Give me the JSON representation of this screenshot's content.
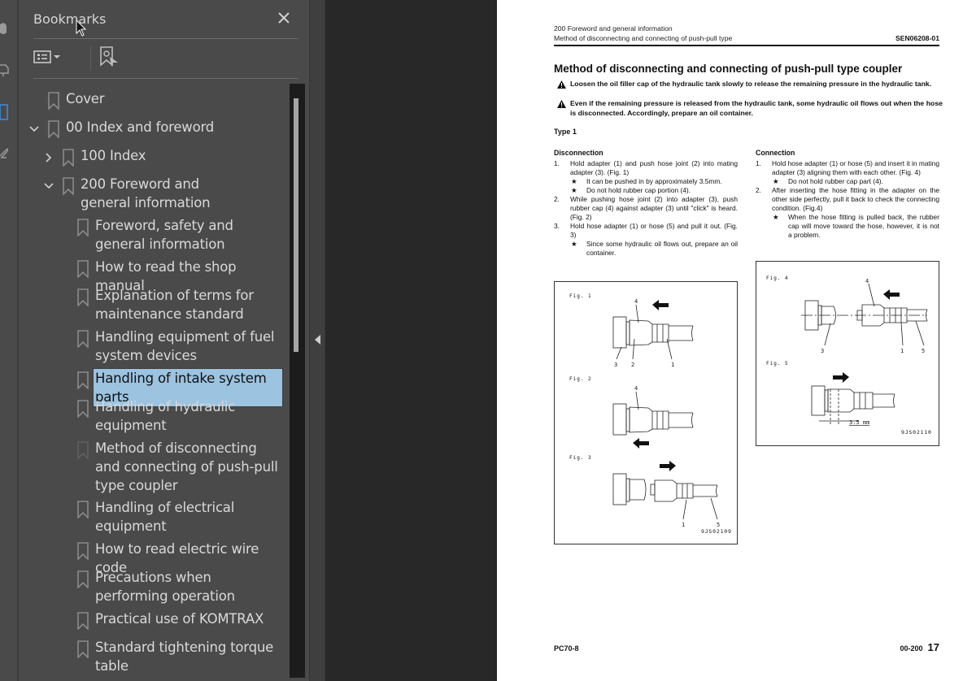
{
  "panel": {
    "title": "Bookmarks",
    "close_label": "Close",
    "options_icon": "list-options-icon",
    "find_bookmark_icon": "find-current-bookmark-icon"
  },
  "bookmarks": [
    {
      "label": "Cover",
      "level": 0,
      "expander": "none",
      "selected": false
    },
    {
      "label": "00 Index and foreword",
      "level": 0,
      "expander": "expanded",
      "selected": false
    },
    {
      "label": "100 Index",
      "level": 1,
      "expander": "collapsed",
      "selected": false
    },
    {
      "label": "200 Foreword and general information",
      "level": 1,
      "expander": "expanded",
      "selected": false
    },
    {
      "label": "Foreword, safety and general information",
      "level": 2,
      "expander": "none",
      "selected": false
    },
    {
      "label": "How to read the shop manual",
      "level": 2,
      "expander": "none",
      "selected": false
    },
    {
      "label": "Explanation of terms for maintenance standard",
      "level": 2,
      "expander": "none",
      "selected": false
    },
    {
      "label": "Handling equipment of fuel system devices",
      "level": 2,
      "expander": "none",
      "selected": false
    },
    {
      "label": "Handling of intake system parts",
      "level": 2,
      "expander": "none",
      "selected": true
    },
    {
      "label": "Handling of hydraulic equipment",
      "level": 2,
      "expander": "none",
      "selected": false
    },
    {
      "label": "Method of disconnecting and connecting of push-pull type coupler",
      "level": 2,
      "expander": "none",
      "selected": false
    },
    {
      "label": "Handling of electrical equipment",
      "level": 2,
      "expander": "none",
      "selected": false
    },
    {
      "label": "How to read electric wire code",
      "level": 2,
      "expander": "none",
      "selected": false
    },
    {
      "label": "Precautions when performing operation",
      "level": 2,
      "expander": "none",
      "selected": false
    },
    {
      "label": "Practical use of KOMTRAX",
      "level": 2,
      "expander": "none",
      "selected": false
    },
    {
      "label": "Standard tightening torque table",
      "level": 2,
      "expander": "none",
      "selected": false
    }
  ],
  "page": {
    "header_line1": "200 Foreword and general information",
    "header_line2": "Method of disconnecting and connecting of push-pull type",
    "doc_code": "SEN06208-01",
    "title": "Method of disconnecting and connecting of push-pull type coupler",
    "warnings": [
      "Loosen the oil filler cap of the hydraulic tank slowly to release the remaining pressure in the hydraulic tank.",
      "Even if the remaining pressure is released from the hydraulic tank, some hydraulic oil flows out when the hose is disconnected. Accordingly, prepare an oil container."
    ],
    "type_label": "Type 1",
    "disconnection": {
      "heading": "Disconnection",
      "steps": [
        {
          "num": "1.",
          "text": "Hold adapter (1) and push hose joint (2) into mating adapter (3).  (Fig. 1)",
          "notes": [
            "It can be pushed in by approximately 3.5mm.",
            "Do not hold rubber cap portion (4)."
          ]
        },
        {
          "num": "2.",
          "text": "While pushing hose joint (2) into adapter (3), push rubber cap (4) against adapter (3) until \"click\" is heard. (Fig. 2)",
          "notes": []
        },
        {
          "num": "3.",
          "text": "Hold hose adapter (1) or hose (5) and pull it out.  (Fig. 3)",
          "notes": [
            "Since some hydraulic oil flows out, prepare an oil container."
          ]
        }
      ]
    },
    "connection": {
      "heading": "Connection",
      "steps": [
        {
          "num": "1.",
          "text": "Hold hose adapter (1) or hose (5) and insert it in mating adapter (3) aligning them with each other. (Fig. 4)",
          "notes": [
            "Do not hold rubber cap part (4)."
          ]
        },
        {
          "num": "2.",
          "text": "After inserting the hose fitting in the adapter on the other side perfectly, pull it back to check the connecting condition. (Fig.4)",
          "notes": [
            "When the hose fitting is pulled back, the rubber cap will move toward the hose, however, it is not a problem."
          ]
        }
      ]
    },
    "star": "★",
    "figures_left": {
      "fig1": "Fig. 1",
      "fig2": "Fig. 2",
      "fig3": "Fig. 3",
      "code": "9JS02109",
      "callouts": {
        "fig1": [
          "4",
          "3",
          "2",
          "1"
        ],
        "fig2": [
          "4"
        ],
        "fig3": [
          "1",
          "5"
        ]
      }
    },
    "figures_right": {
      "fig4": "Fig. 4",
      "fig5": "Fig. 5",
      "code": "9JS02110",
      "dimension": "3.5 mm",
      "callouts": {
        "fig4": [
          "4",
          "3",
          "1",
          "5"
        ]
      }
    },
    "footer_model": "PC70-8",
    "footer_section": "00-200",
    "page_number": "17"
  }
}
